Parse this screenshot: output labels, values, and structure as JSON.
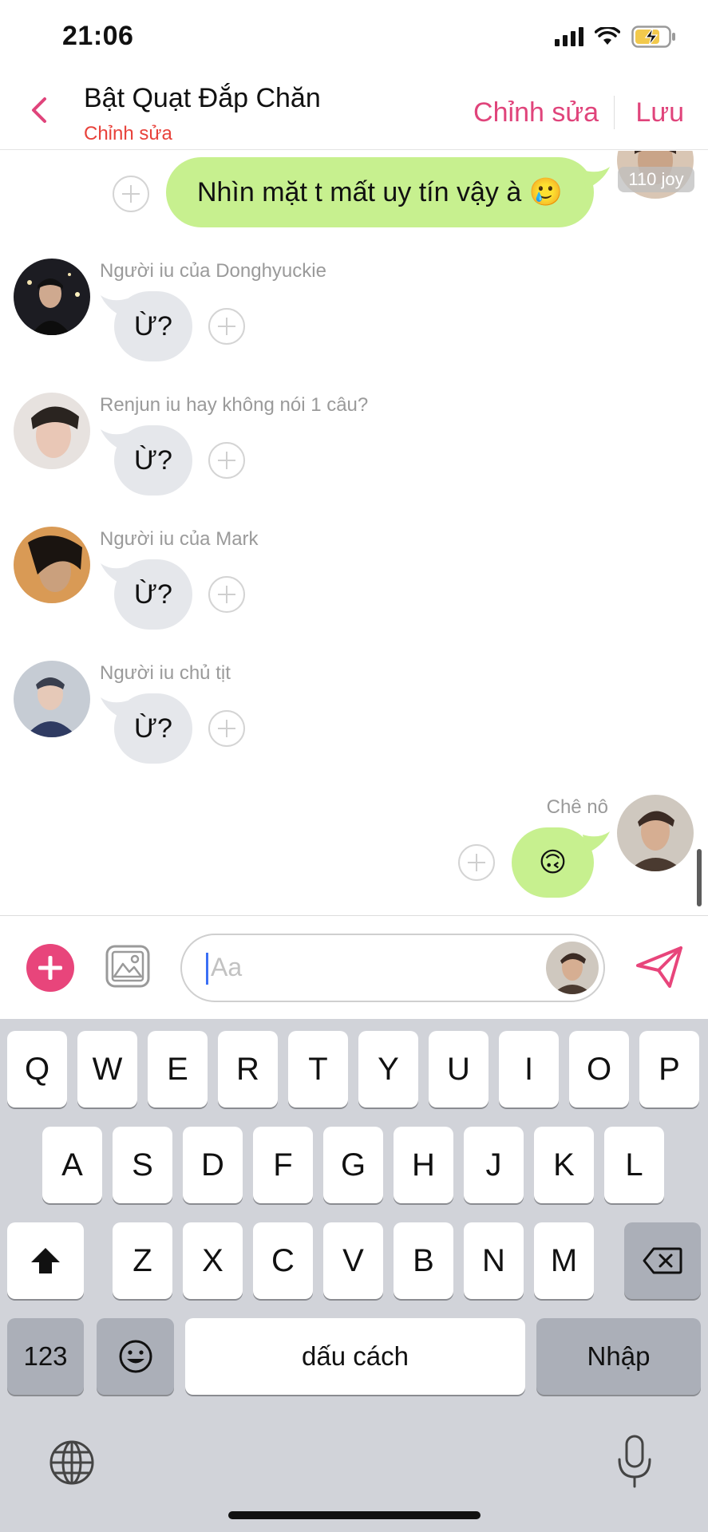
{
  "status_bar": {
    "time": "21:06"
  },
  "header": {
    "title": "Bật Quạt Đắp Chăn",
    "subtitle": "Chỉnh sửa",
    "edit_label": "Chỉnh sửa",
    "save_label": "Lưu"
  },
  "messages": [
    {
      "direction": "out",
      "text": "Nhìn mặt t mất uy tín vậy à 🥲",
      "badge": "110 joy"
    },
    {
      "direction": "in",
      "sender": "Người iu của Donghyuckie",
      "text": "Ừ?"
    },
    {
      "direction": "in",
      "sender": "Renjun iu hay không nói 1 câu?",
      "text": "Ừ?"
    },
    {
      "direction": "in",
      "sender": "Người iu của Mark",
      "text": "Ừ?"
    },
    {
      "direction": "in",
      "sender": "Người iu chủ tịt",
      "text": "Ừ?"
    },
    {
      "direction": "out",
      "sender": "Chê nô",
      "text": "🙃"
    }
  ],
  "composer": {
    "placeholder": "Aa"
  },
  "keyboard": {
    "row1": [
      "Q",
      "W",
      "E",
      "R",
      "T",
      "Y",
      "U",
      "I",
      "O",
      "P"
    ],
    "row2": [
      "A",
      "S",
      "D",
      "F",
      "G",
      "H",
      "J",
      "K",
      "L"
    ],
    "row3": [
      "Z",
      "X",
      "C",
      "V",
      "B",
      "N",
      "M"
    ],
    "numbers_label": "123",
    "space_label": "dấu cách",
    "return_label": "Nhập"
  },
  "colors": {
    "accent_pink": "#e0447b",
    "subtitle_red": "#e8423b",
    "outgoing_bubble": "#c7f08f",
    "incoming_bubble": "#e5e7eb"
  }
}
